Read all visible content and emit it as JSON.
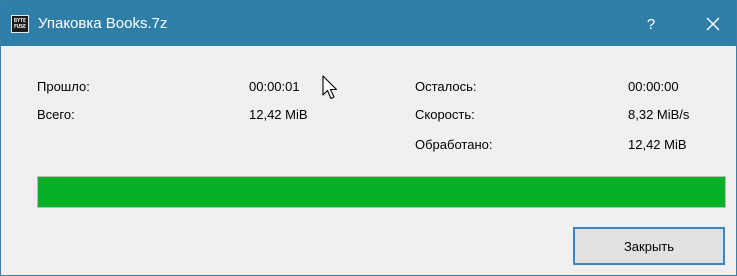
{
  "window": {
    "title": "Упаковка Books.7z",
    "app_icon_text_top": "BYTE",
    "app_icon_text_bottom": "FUSE",
    "help_label": "?"
  },
  "stats": {
    "elapsed_label": "Прошло:",
    "elapsed_value": "00:00:01",
    "total_label": "Всего:",
    "total_value": "12,42 MiB",
    "remaining_label": "Осталось:",
    "remaining_value": "00:00:00",
    "speed_label": "Скорость:",
    "speed_value": "8,32 MiB/s",
    "processed_label": "Обработано:",
    "processed_value": "12,42 MiB"
  },
  "progress": {
    "percent": 100,
    "color": "#06b025"
  },
  "footer": {
    "close_label": "Закрыть"
  },
  "colors": {
    "titlebar": "#2f7ea8",
    "window_bg": "#f0f0f0",
    "button_border": "#3b84c4"
  }
}
